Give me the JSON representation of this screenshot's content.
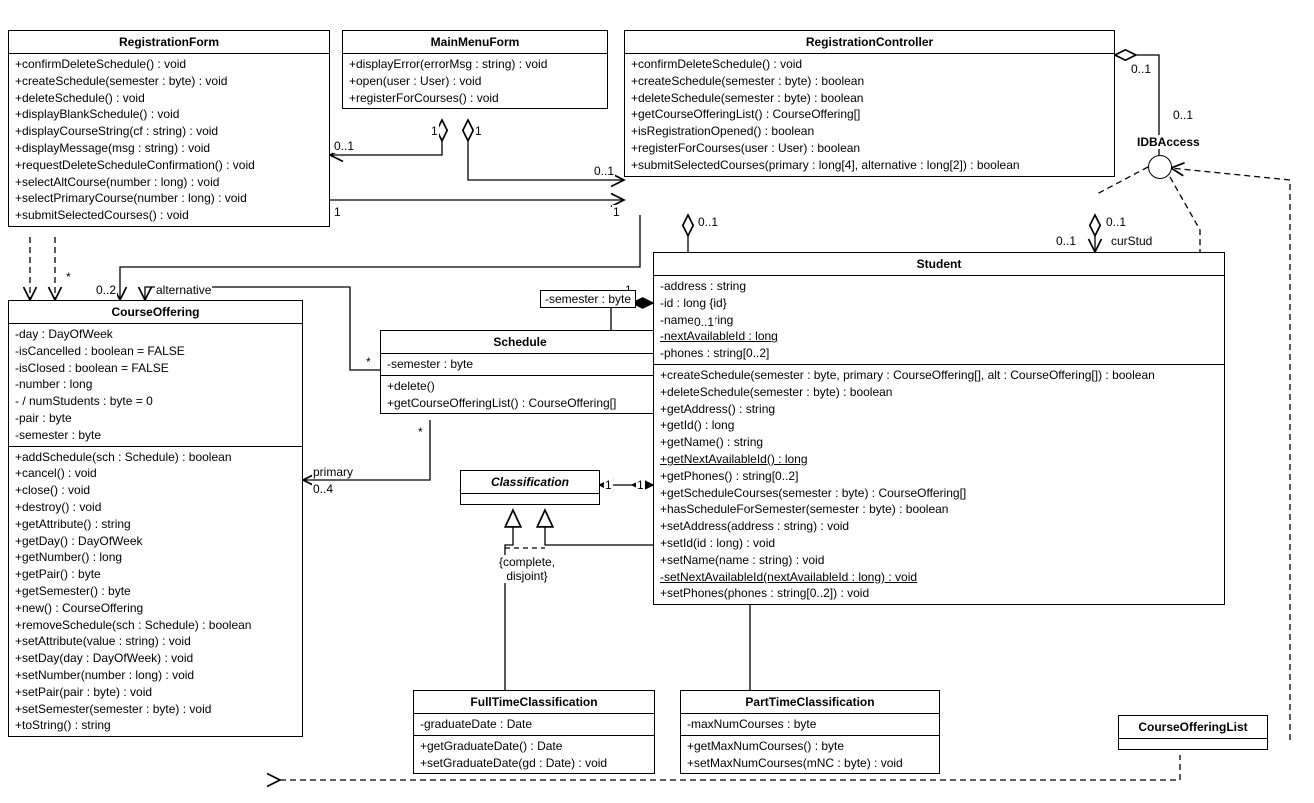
{
  "classes": {
    "registrationForm": {
      "name": "RegistrationForm",
      "methods": [
        "+confirmDeleteSchedule() : void",
        "+createSchedule(semester : byte) : void",
        "+deleteSchedule() : void",
        "+displayBlankSchedule() : void",
        "+displayCourseString(cf : string) : void",
        "+displayMessage(msg : string) : void",
        "+requestDeleteScheduleConfirmation() : void",
        "+selectAltCourse(number : long) : void",
        "+selectPrimaryCourse(number : long) : void",
        "+submitSelectedCourses() : void"
      ]
    },
    "mainMenuForm": {
      "name": "MainMenuForm",
      "methods": [
        "+displayError(errorMsg : string) : void",
        "+open(user : User) : void",
        "+registerForCourses() : void"
      ]
    },
    "registrationController": {
      "name": "RegistrationController",
      "methods": [
        "+confirmDeleteSchedule() : void",
        "+createSchedule(semester : byte) : boolean",
        "+deleteSchedule(semester : byte) : boolean",
        "+getCourseOfferingList() : CourseOffering[]",
        "+isRegistrationOpened() : boolean",
        "+registerForCourses(user : User) : boolean",
        "+submitSelectedCourses(primary : long[4], alternative : long[2]) : boolean"
      ]
    },
    "courseOffering": {
      "name": "CourseOffering",
      "attrs": [
        "-day : DayOfWeek",
        "-isCancelled : boolean = FALSE",
        "-isClosed : boolean = FALSE",
        "-number : long",
        "- / numStudents : byte = 0",
        "-pair : byte",
        "-semester : byte"
      ],
      "methods": [
        "+addSchedule(sch : Schedule) : boolean",
        "+cancel() : void",
        "+close() : void",
        "+destroy() : void",
        "+getAttribute() : string",
        "+getDay() : DayOfWeek",
        "+getNumber() : long",
        "+getPair() : byte",
        "+getSemester() : byte",
        "+new() : CourseOffering",
        "+removeSchedule(sch : Schedule) : boolean",
        "+setAttribute(value : string) : void",
        "+setDay(day : DayOfWeek) : void",
        "+setNumber(number : long) : void",
        "+setPair(pair : byte) : void",
        "+setSemester(semester : byte) : void",
        "+toString() : string"
      ]
    },
    "schedule": {
      "name": "Schedule",
      "attrs": [
        "-semester : byte"
      ],
      "methods": [
        "+delete()",
        "+getCourseOfferingList() : CourseOffering[]"
      ]
    },
    "classification": {
      "name": "Classification"
    },
    "student": {
      "name": "Student",
      "attrs": [
        "-address : string",
        "-id : long {id}",
        "-name : string",
        "-nextAvailableId : long",
        "-phones : string[0..2]"
      ],
      "methods": [
        "+createSchedule(semester : byte, primary : CourseOffering[], alt : CourseOffering[]) : boolean",
        "+deleteSchedule(semester : byte) : boolean",
        "+getAddress() : string",
        "+getId() : long",
        "+getName() : string",
        "+getNextAvailableId() : long",
        "+getPhones() : string[0..2]",
        "+getScheduleCourses(semester : byte) : CourseOffering[]",
        "+hasScheduleForSemester(semester : byte) : boolean",
        "+setAddress(address : string) : void",
        "+setId(id : long) : void",
        "+setName(name : string) : void",
        "-setNextAvailableId(nextAvailableId : long) : void",
        "+setPhones(phones : string[0..2]) : void"
      ]
    },
    "fullTimeClassification": {
      "name": "FullTimeClassification",
      "attrs": [
        "-graduateDate : Date"
      ],
      "methods": [
        "+getGraduateDate() : Date",
        "+setGraduateDate(gd : Date) : void"
      ]
    },
    "partTimeClassification": {
      "name": "PartTimeClassification",
      "attrs": [
        "-maxNumCourses : byte"
      ],
      "methods": [
        "+getMaxNumCourses() : byte",
        "+setMaxNumCourses(mNC : byte) : void"
      ]
    },
    "courseOfferingList": {
      "name": "CourseOfferingList"
    },
    "idbAccess": {
      "name": "IDBAccess"
    }
  },
  "labels": {
    "alternative": "alternative",
    "primary": "primary",
    "curStud": "curStud",
    "semester": "-semester : byte",
    "constraint": "{complete,\ndisjoint}",
    "m_0_1": "0..1",
    "m_0_2": "0..2",
    "m_0_4": "0..4",
    "m_1": "1",
    "m_star": "*"
  }
}
